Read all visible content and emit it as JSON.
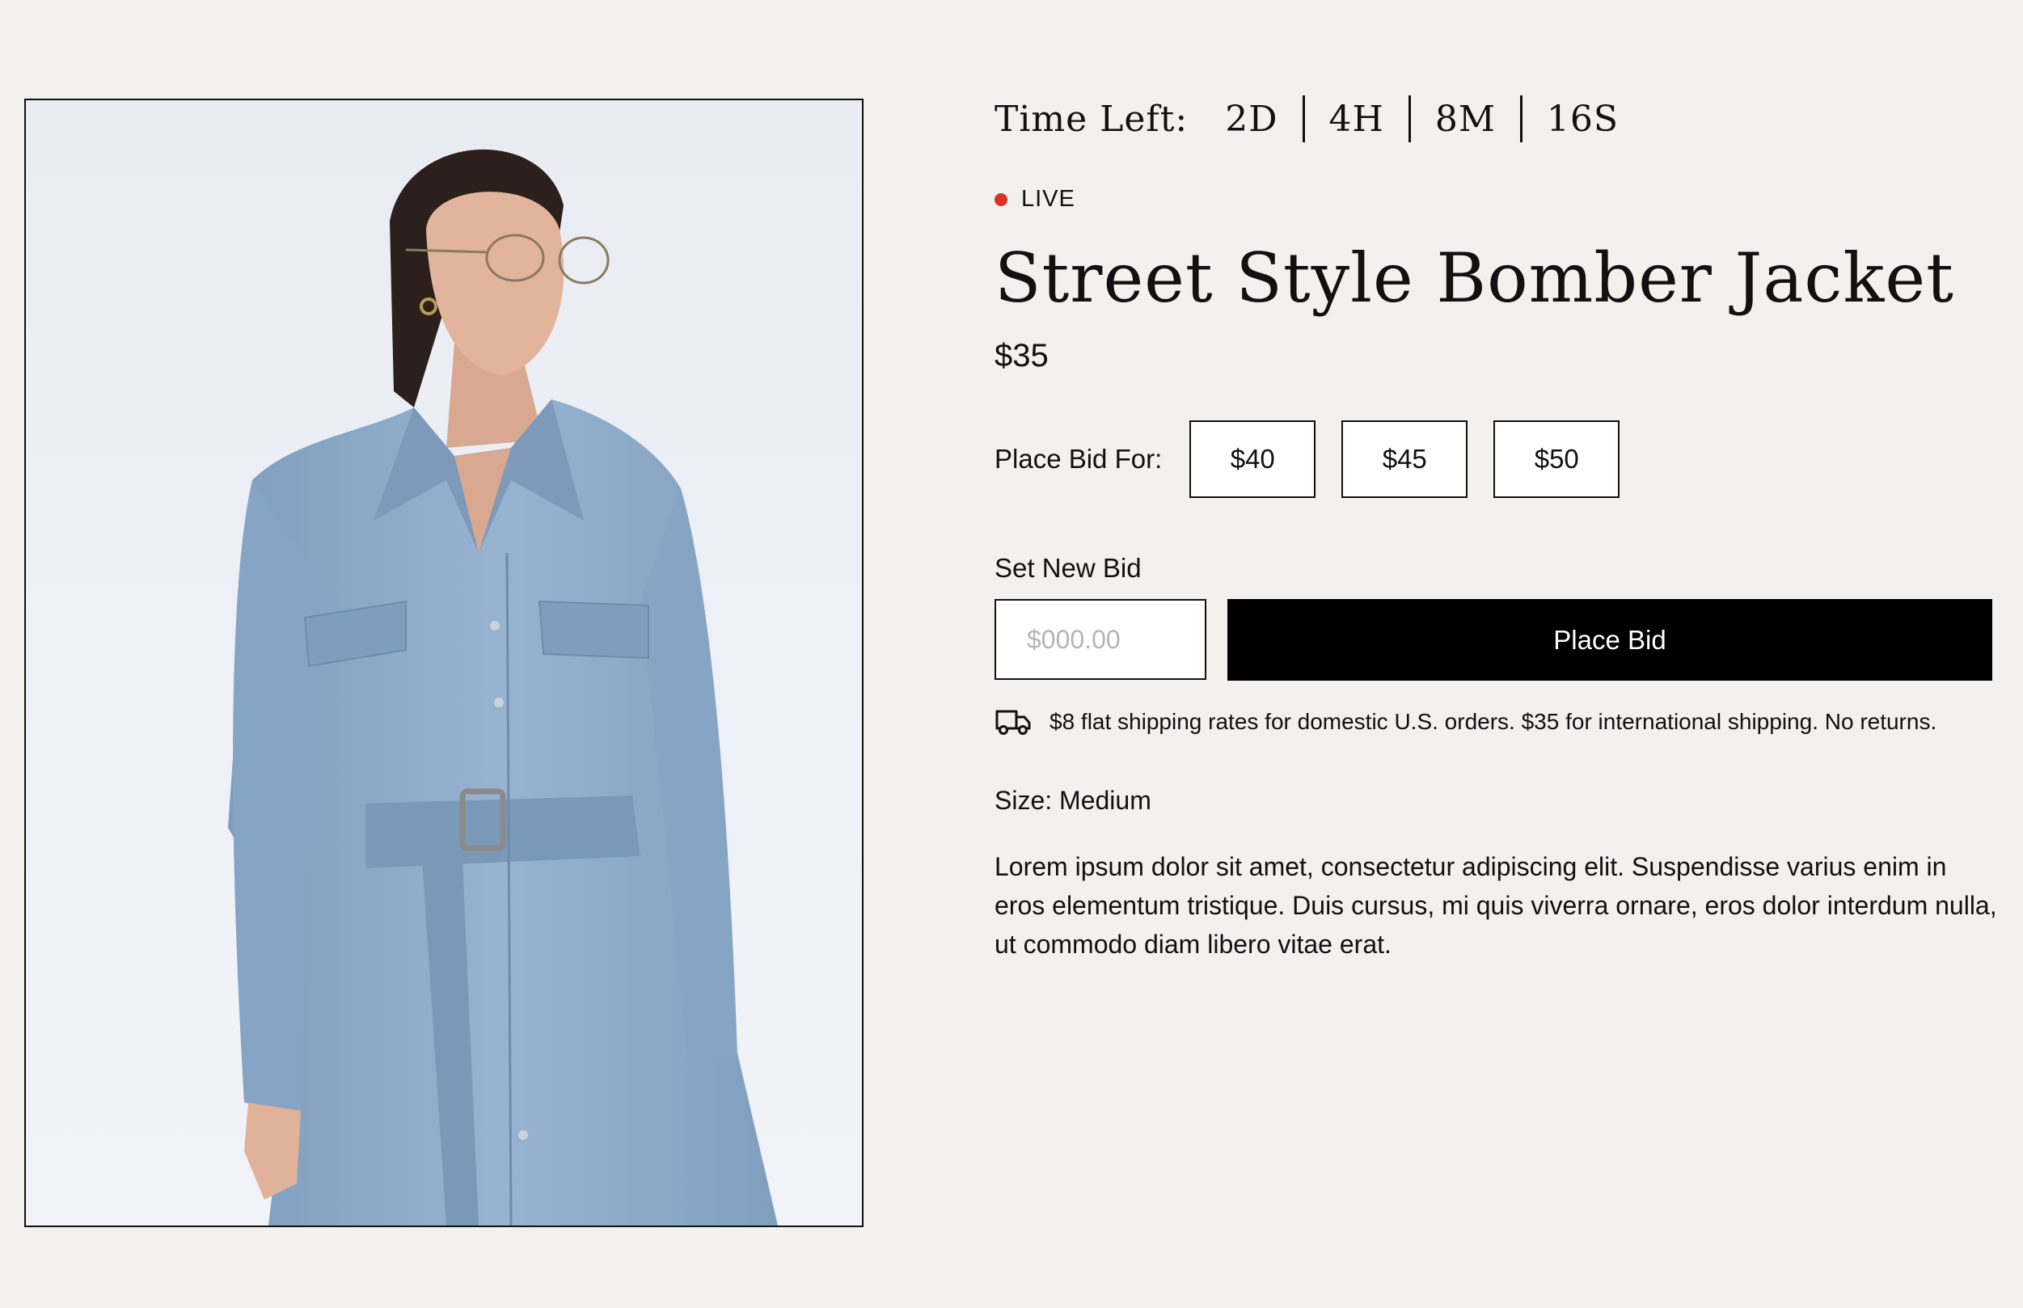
{
  "product_image": {
    "alt": "model-wearing-light-blue-belted-shirt-dress"
  },
  "timer": {
    "label": "Time Left:",
    "days": "2D",
    "hours": "4H",
    "minutes": "8M",
    "seconds": "16S"
  },
  "status": {
    "label": "LIVE",
    "color": "#e03024"
  },
  "product": {
    "title": "Street Style Bomber Jacket",
    "price": "$35",
    "size": "Size: Medium",
    "description": "Lorem ipsum dolor sit amet, consectetur adipiscing elit. Suspendisse varius enim in eros elementum tristique. Duis cursus, mi quis viverra ornare, eros dolor interdum nulla, ut commodo diam libero vitae erat."
  },
  "bidding": {
    "quick_label": "Place Bid For:",
    "options": [
      "$40",
      "$45",
      "$50"
    ],
    "set_label": "Set New Bid",
    "input_placeholder": "$000.00",
    "input_value": "",
    "submit_label": "Place Bid"
  },
  "shipping": {
    "icon": "truck-icon",
    "text": "$8 flat shipping rates for domestic U.S. orders. $35 for international shipping. No returns."
  },
  "colors": {
    "background": "#f2f1ee",
    "button": "#000000",
    "garment": "#8faccb"
  }
}
